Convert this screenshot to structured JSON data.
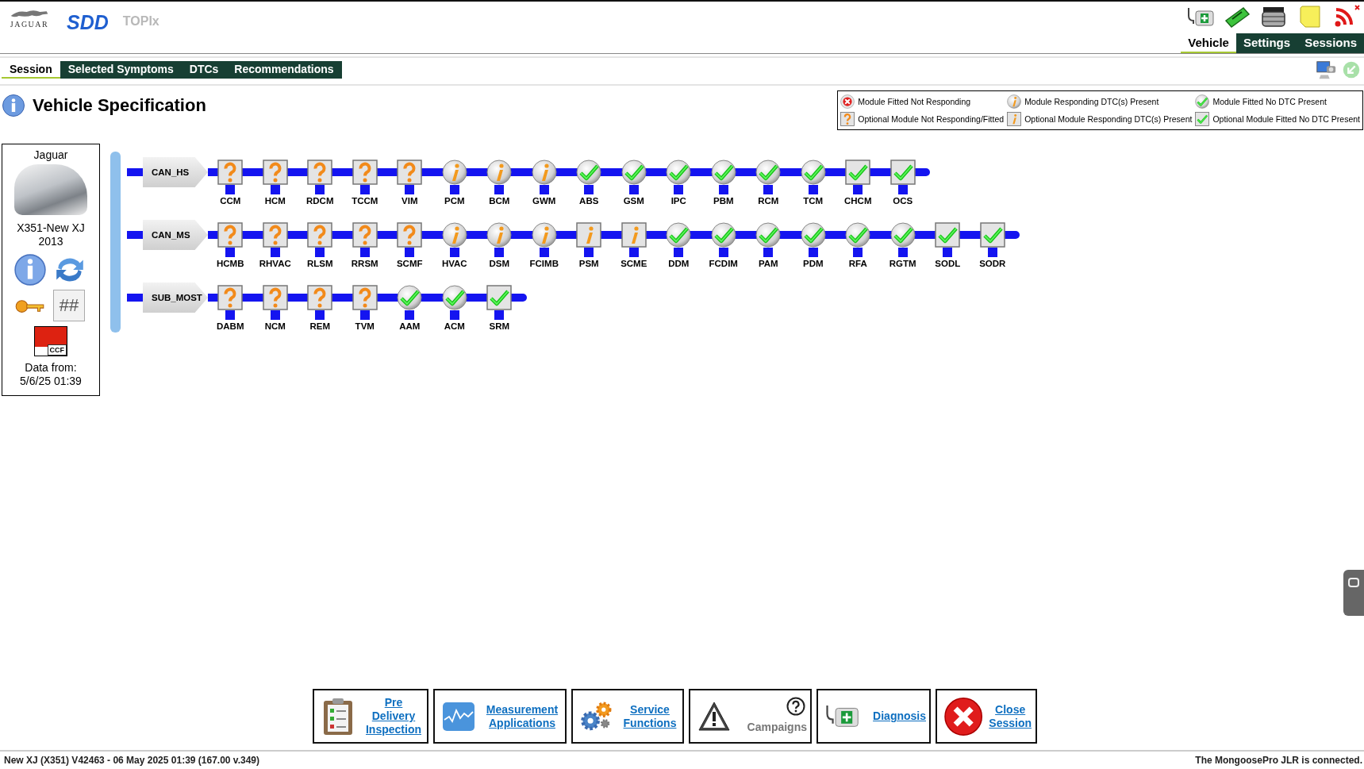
{
  "brand": {
    "maker": "JAGUAR",
    "product": "SDD",
    "module": "TOPIx"
  },
  "nav_tabs": [
    {
      "label": "Vehicle",
      "selected": true
    },
    {
      "label": "Settings",
      "selected": false
    },
    {
      "label": "Sessions",
      "selected": false
    }
  ],
  "session_tabs": [
    {
      "label": "Session",
      "selected": true
    },
    {
      "label": "Selected Symptoms",
      "selected": false
    },
    {
      "label": "DTCs",
      "selected": false
    },
    {
      "label": "Recommendations",
      "selected": false
    }
  ],
  "page_title": "Vehicle Specification",
  "legend": [
    {
      "label": "Module Fitted Not Responding",
      "kind": "fitted-fail"
    },
    {
      "label": "Module Responding DTC(s) Present",
      "kind": "fitted-dtc"
    },
    {
      "label": "Module Fitted No DTC Present",
      "kind": "fitted-ok"
    },
    {
      "label": "Optional Module Not Responding/Fitted",
      "kind": "optional-unknown"
    },
    {
      "label": "Optional Module Responding DTC(s) Present",
      "kind": "optional-dtc"
    },
    {
      "label": "Optional Module Fitted No DTC Present",
      "kind": "optional-ok"
    }
  ],
  "vehicle": {
    "make": "Jaguar",
    "model": "X351-New XJ",
    "year": "2013",
    "hash_label": "##",
    "ccf_label": "CCF",
    "data_from_label": "Data from:",
    "data_from": "5/6/25 01:39"
  },
  "buses": [
    {
      "name": "CAN_HS",
      "modules": [
        {
          "name": "CCM",
          "kind": "optional-unknown"
        },
        {
          "name": "HCM",
          "kind": "optional-unknown"
        },
        {
          "name": "RDCM",
          "kind": "optional-unknown"
        },
        {
          "name": "TCCM",
          "kind": "optional-unknown"
        },
        {
          "name": "VIM",
          "kind": "optional-unknown"
        },
        {
          "name": "PCM",
          "kind": "fitted-dtc"
        },
        {
          "name": "BCM",
          "kind": "fitted-dtc"
        },
        {
          "name": "GWM",
          "kind": "fitted-dtc"
        },
        {
          "name": "ABS",
          "kind": "fitted-ok"
        },
        {
          "name": "GSM",
          "kind": "fitted-ok"
        },
        {
          "name": "IPC",
          "kind": "fitted-ok"
        },
        {
          "name": "PBM",
          "kind": "fitted-ok"
        },
        {
          "name": "RCM",
          "kind": "fitted-ok"
        },
        {
          "name": "TCM",
          "kind": "fitted-ok"
        },
        {
          "name": "CHCM",
          "kind": "optional-ok"
        },
        {
          "name": "OCS",
          "kind": "optional-ok"
        }
      ]
    },
    {
      "name": "CAN_MS",
      "modules": [
        {
          "name": "HCMB",
          "kind": "optional-unknown"
        },
        {
          "name": "RHVAC",
          "kind": "optional-unknown"
        },
        {
          "name": "RLSM",
          "kind": "optional-unknown"
        },
        {
          "name": "RRSM",
          "kind": "optional-unknown"
        },
        {
          "name": "SCMF",
          "kind": "optional-unknown"
        },
        {
          "name": "HVAC",
          "kind": "fitted-dtc"
        },
        {
          "name": "DSM",
          "kind": "fitted-dtc"
        },
        {
          "name": "FCIMB",
          "kind": "fitted-dtc"
        },
        {
          "name": "PSM",
          "kind": "optional-dtc"
        },
        {
          "name": "SCME",
          "kind": "optional-dtc"
        },
        {
          "name": "DDM",
          "kind": "fitted-ok"
        },
        {
          "name": "FCDIM",
          "kind": "fitted-ok"
        },
        {
          "name": "PAM",
          "kind": "fitted-ok"
        },
        {
          "name": "PDM",
          "kind": "fitted-ok"
        },
        {
          "name": "RFA",
          "kind": "fitted-ok"
        },
        {
          "name": "RGTM",
          "kind": "fitted-ok"
        },
        {
          "name": "SODL",
          "kind": "optional-ok"
        },
        {
          "name": "SODR",
          "kind": "optional-ok"
        }
      ]
    },
    {
      "name": "SUB_MOST",
      "modules": [
        {
          "name": "DABM",
          "kind": "optional-unknown"
        },
        {
          "name": "NCM",
          "kind": "optional-unknown"
        },
        {
          "name": "REM",
          "kind": "optional-unknown"
        },
        {
          "name": "TVM",
          "kind": "optional-unknown"
        },
        {
          "name": "AAM",
          "kind": "fitted-ok"
        },
        {
          "name": "ACM",
          "kind": "fitted-ok"
        },
        {
          "name": "SRM",
          "kind": "optional-ok"
        }
      ]
    }
  ],
  "actions": [
    {
      "label": "Pre Delivery Inspection",
      "enabled": true
    },
    {
      "label": "Measurement Applications",
      "enabled": true
    },
    {
      "label": "Service Functions",
      "enabled": true
    },
    {
      "label": "Campaigns",
      "enabled": false
    },
    {
      "label": "Diagnosis",
      "enabled": true
    },
    {
      "label": "Close Session",
      "enabled": true
    }
  ],
  "status_bar": {
    "left": "New XJ (X351) V42463 - 06 May 2025 01:39 (167.00 v.349)",
    "right": "The MongoosePro JLR is connected."
  }
}
